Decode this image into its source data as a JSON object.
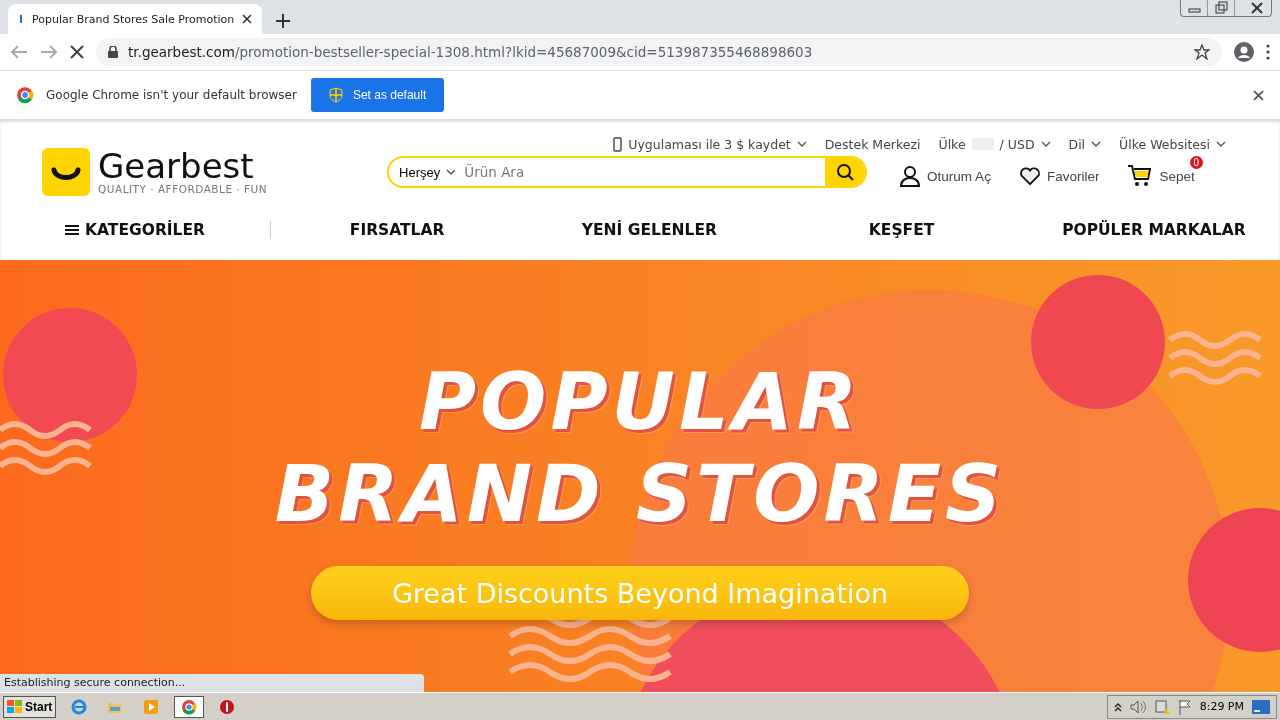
{
  "browser": {
    "tab_title": "Popular Brand Stores Sale Promotion",
    "url_host": "tr.gearbest.com",
    "url_path": "/promotion-bestseller-special-1308.html?lkid=45687009&cid=513987355468898603",
    "loading": true
  },
  "infobar": {
    "message": "Google Chrome isn't your default browser",
    "button": "Set as default"
  },
  "site": {
    "logo": "Gearbest",
    "tagline": "QUALITY · AFFORDABLE · FUN",
    "top_links": [
      {
        "label": "Uygulaması ile 3 $ kaydet",
        "kind": "phone"
      },
      {
        "label": "Destek Merkezi",
        "kind": "plain"
      },
      {
        "label": "Ülke",
        "kind": "country",
        "suffix": "/ USD"
      },
      {
        "label": "Dil",
        "kind": "dropdown"
      },
      {
        "label": "Ülke Websitesi",
        "kind": "dropdown"
      }
    ],
    "search": {
      "category": "Herşey",
      "placeholder": "Ürün Ara"
    },
    "actions": [
      {
        "label": "Oturum Aç",
        "kind": "user"
      },
      {
        "label": "Favoriler",
        "kind": "heart"
      },
      {
        "label": "Sepet",
        "kind": "cart",
        "badge": "0"
      }
    ],
    "nav": [
      {
        "label": "KATEGORİLER",
        "kind": "menu"
      },
      {
        "label": "FIRSATLAR",
        "kind": "link"
      },
      {
        "label": "YENİ GELENLER",
        "kind": "link"
      },
      {
        "label": "KEŞFET",
        "kind": "link"
      },
      {
        "label": "POPÜLER MARKALAR",
        "kind": "link"
      }
    ]
  },
  "banner": {
    "title_lines": [
      "POPULAR",
      "BRAND STORES"
    ],
    "subtitle": "Great Discounts Beyond Imagination"
  },
  "status_bubble": "Establishing secure connection...",
  "taskbar": {
    "start": "Start",
    "apps": [
      {
        "kind": "ie",
        "selected": false
      },
      {
        "kind": "folder",
        "selected": false
      },
      {
        "kind": "media",
        "selected": false
      },
      {
        "kind": "chrome",
        "selected": true
      },
      {
        "kind": "stop",
        "selected": false
      }
    ],
    "clock": "8:29 PM"
  }
}
